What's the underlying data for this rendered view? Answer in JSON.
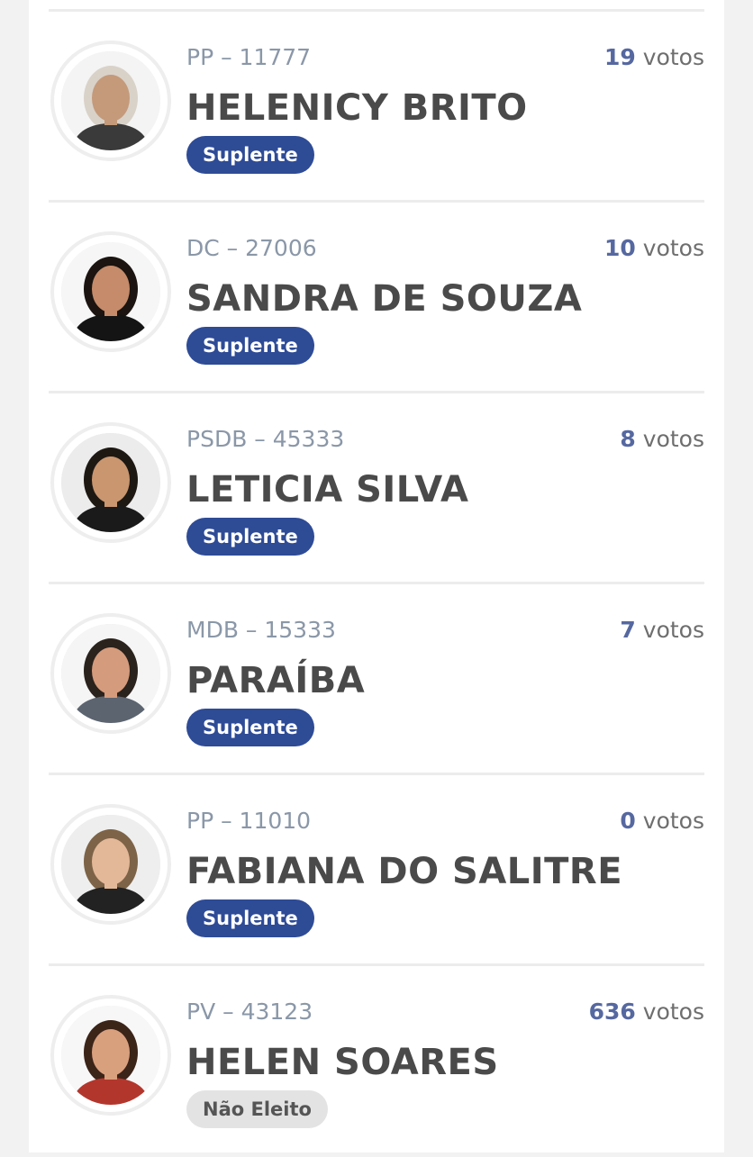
{
  "candidates": [
    {
      "party_number": "PP – 11777",
      "votes_count": "19",
      "votes_label": "votos",
      "name": "HELENICY BRITO",
      "status": "Suplente",
      "status_type": "suplente",
      "avatar": {
        "hair": "#d9d2c9",
        "skin": "#c49a7a",
        "shirt": "#3a3a3a",
        "bg": "#f4f4f4"
      }
    },
    {
      "party_number": "DC – 27006",
      "votes_count": "10",
      "votes_label": "votos",
      "name": "SANDRA DE SOUZA",
      "status": "Suplente",
      "status_type": "suplente",
      "avatar": {
        "hair": "#1b1410",
        "skin": "#c58b6a",
        "shirt": "#141414",
        "bg": "#f6f6f6"
      }
    },
    {
      "party_number": "PSDB – 45333",
      "votes_count": "8",
      "votes_label": "votos",
      "name": "LETICIA SILVA",
      "status": "Suplente",
      "status_type": "suplente",
      "avatar": {
        "hair": "#1e1813",
        "skin": "#c9966f",
        "shirt": "#1a1a1a",
        "bg": "#ececec"
      }
    },
    {
      "party_number": "MDB – 15333",
      "votes_count": "7",
      "votes_label": "votos",
      "name": "PARAÍBA",
      "status": "Suplente",
      "status_type": "suplente",
      "avatar": {
        "hair": "#2a221c",
        "skin": "#d49b7c",
        "shirt": "#5c6470",
        "bg": "#f5f5f5"
      }
    },
    {
      "party_number": "PP – 11010",
      "votes_count": "0",
      "votes_label": "votos",
      "name": "FABIANA DO SALITRE",
      "status": "Suplente",
      "status_type": "suplente",
      "avatar": {
        "hair": "#7d6347",
        "skin": "#e3b898",
        "shirt": "#222222",
        "bg": "#eeeeee"
      }
    },
    {
      "party_number": "PV – 43123",
      "votes_count": "636",
      "votes_label": "votos",
      "name": "HELEN SOARES",
      "status": "Não Eleito",
      "status_type": "nao-eleito",
      "avatar": {
        "hair": "#3b2418",
        "skin": "#d9a07e",
        "shirt": "#b3362c",
        "bg": "#f7f7f7"
      }
    }
  ],
  "colors": {
    "badge_suplente": "#2e4b96",
    "badge_nao_eleito": "#e3e3e3",
    "votes_number": "#5668a0",
    "party_text": "#8a97a8",
    "name_text": "#4a4a4a"
  }
}
